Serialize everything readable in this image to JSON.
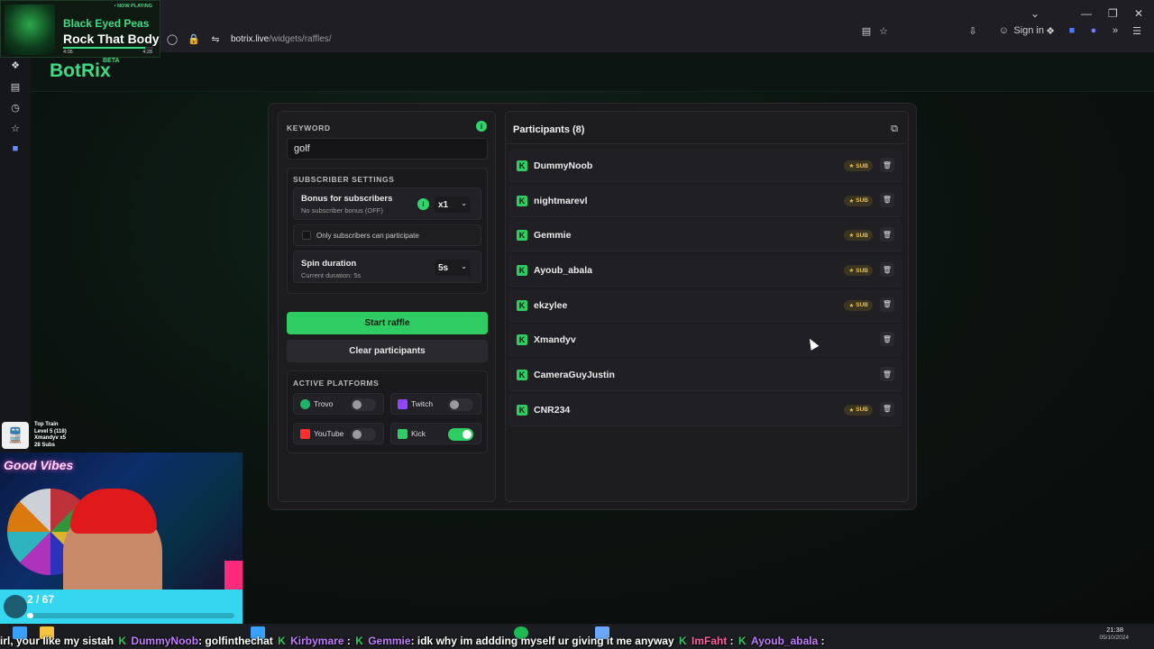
{
  "browser": {
    "url_host": "botrix.live",
    "url_path": "/widgets/raffles/",
    "sign_in_label": "Sign in"
  },
  "app": {
    "brand": "BotRix",
    "brand_tag": "BETA"
  },
  "raffle": {
    "keyword_label": "KEYWORD",
    "keyword_value": "golf",
    "subscriber_settings_title": "SUBSCRIBER SETTINGS",
    "bonus_title": "Bonus for subscribers",
    "bonus_sub": "No subscriber bonus (OFF)",
    "bonus_value": "x1",
    "only_subs_label": "Only subscribers can participate",
    "only_subs_checked": false,
    "spin_title": "Spin duration",
    "spin_sub": "Current duration: 5s",
    "spin_value": "5s",
    "start_label": "Start raffle",
    "clear_label": "Clear participants",
    "platforms_title": "ACTIVE PLATFORMS",
    "platforms": [
      {
        "name": "Trovo",
        "enabled": false,
        "color": "#1fb36a"
      },
      {
        "name": "Twitch",
        "enabled": false,
        "color": "#9146ff"
      },
      {
        "name": "YouTube",
        "enabled": false,
        "color": "#ff2d2d"
      },
      {
        "name": "Kick",
        "enabled": true,
        "color": "#2ecc63"
      }
    ]
  },
  "participants": {
    "title": "Participants (8)",
    "sub_label": "SUB",
    "list": [
      {
        "name": "DummyNoob",
        "sub": true
      },
      {
        "name": "nightmarevl",
        "sub": true
      },
      {
        "name": "Gemmie",
        "sub": true
      },
      {
        "name": "Ayoub_abala",
        "sub": true
      },
      {
        "name": "ekzylee",
        "sub": true
      },
      {
        "name": "Xmandyv",
        "sub": false
      },
      {
        "name": "CameraGuyJustin",
        "sub": false
      },
      {
        "name": "CNR234",
        "sub": true
      }
    ]
  },
  "now_playing": {
    "tag": "• NOW PLAYING",
    "artist": "Black Eyed Peas",
    "title": "Rock That Body",
    "elapsed": "4:05",
    "total": "4:28",
    "progress": 0.91
  },
  "train": {
    "line1": "Top Train",
    "line2": "Level 5 (118)",
    "line3": "Xmandyv x5",
    "line4": "28 Subs"
  },
  "webcam": {
    "sign": "Good Vibes"
  },
  "goal": {
    "text": "2 / 67",
    "progress": 0.03
  },
  "taskbar": {
    "time": "21:38",
    "date": "05/10/2024"
  },
  "ticker": {
    "a": "irl, your like my sistah",
    "name1": "DummyNoob",
    "msg1": ": golfinthechat",
    "name2": "Kirbymare",
    "msg2": ":",
    "name3": "Gemmie",
    "msg3": ": idk why im addding myself ur giving it me anyway",
    "name4": "ImFaht",
    "msg4": ":",
    "name5": "Ayoub_abala",
    "msg5": ":"
  }
}
